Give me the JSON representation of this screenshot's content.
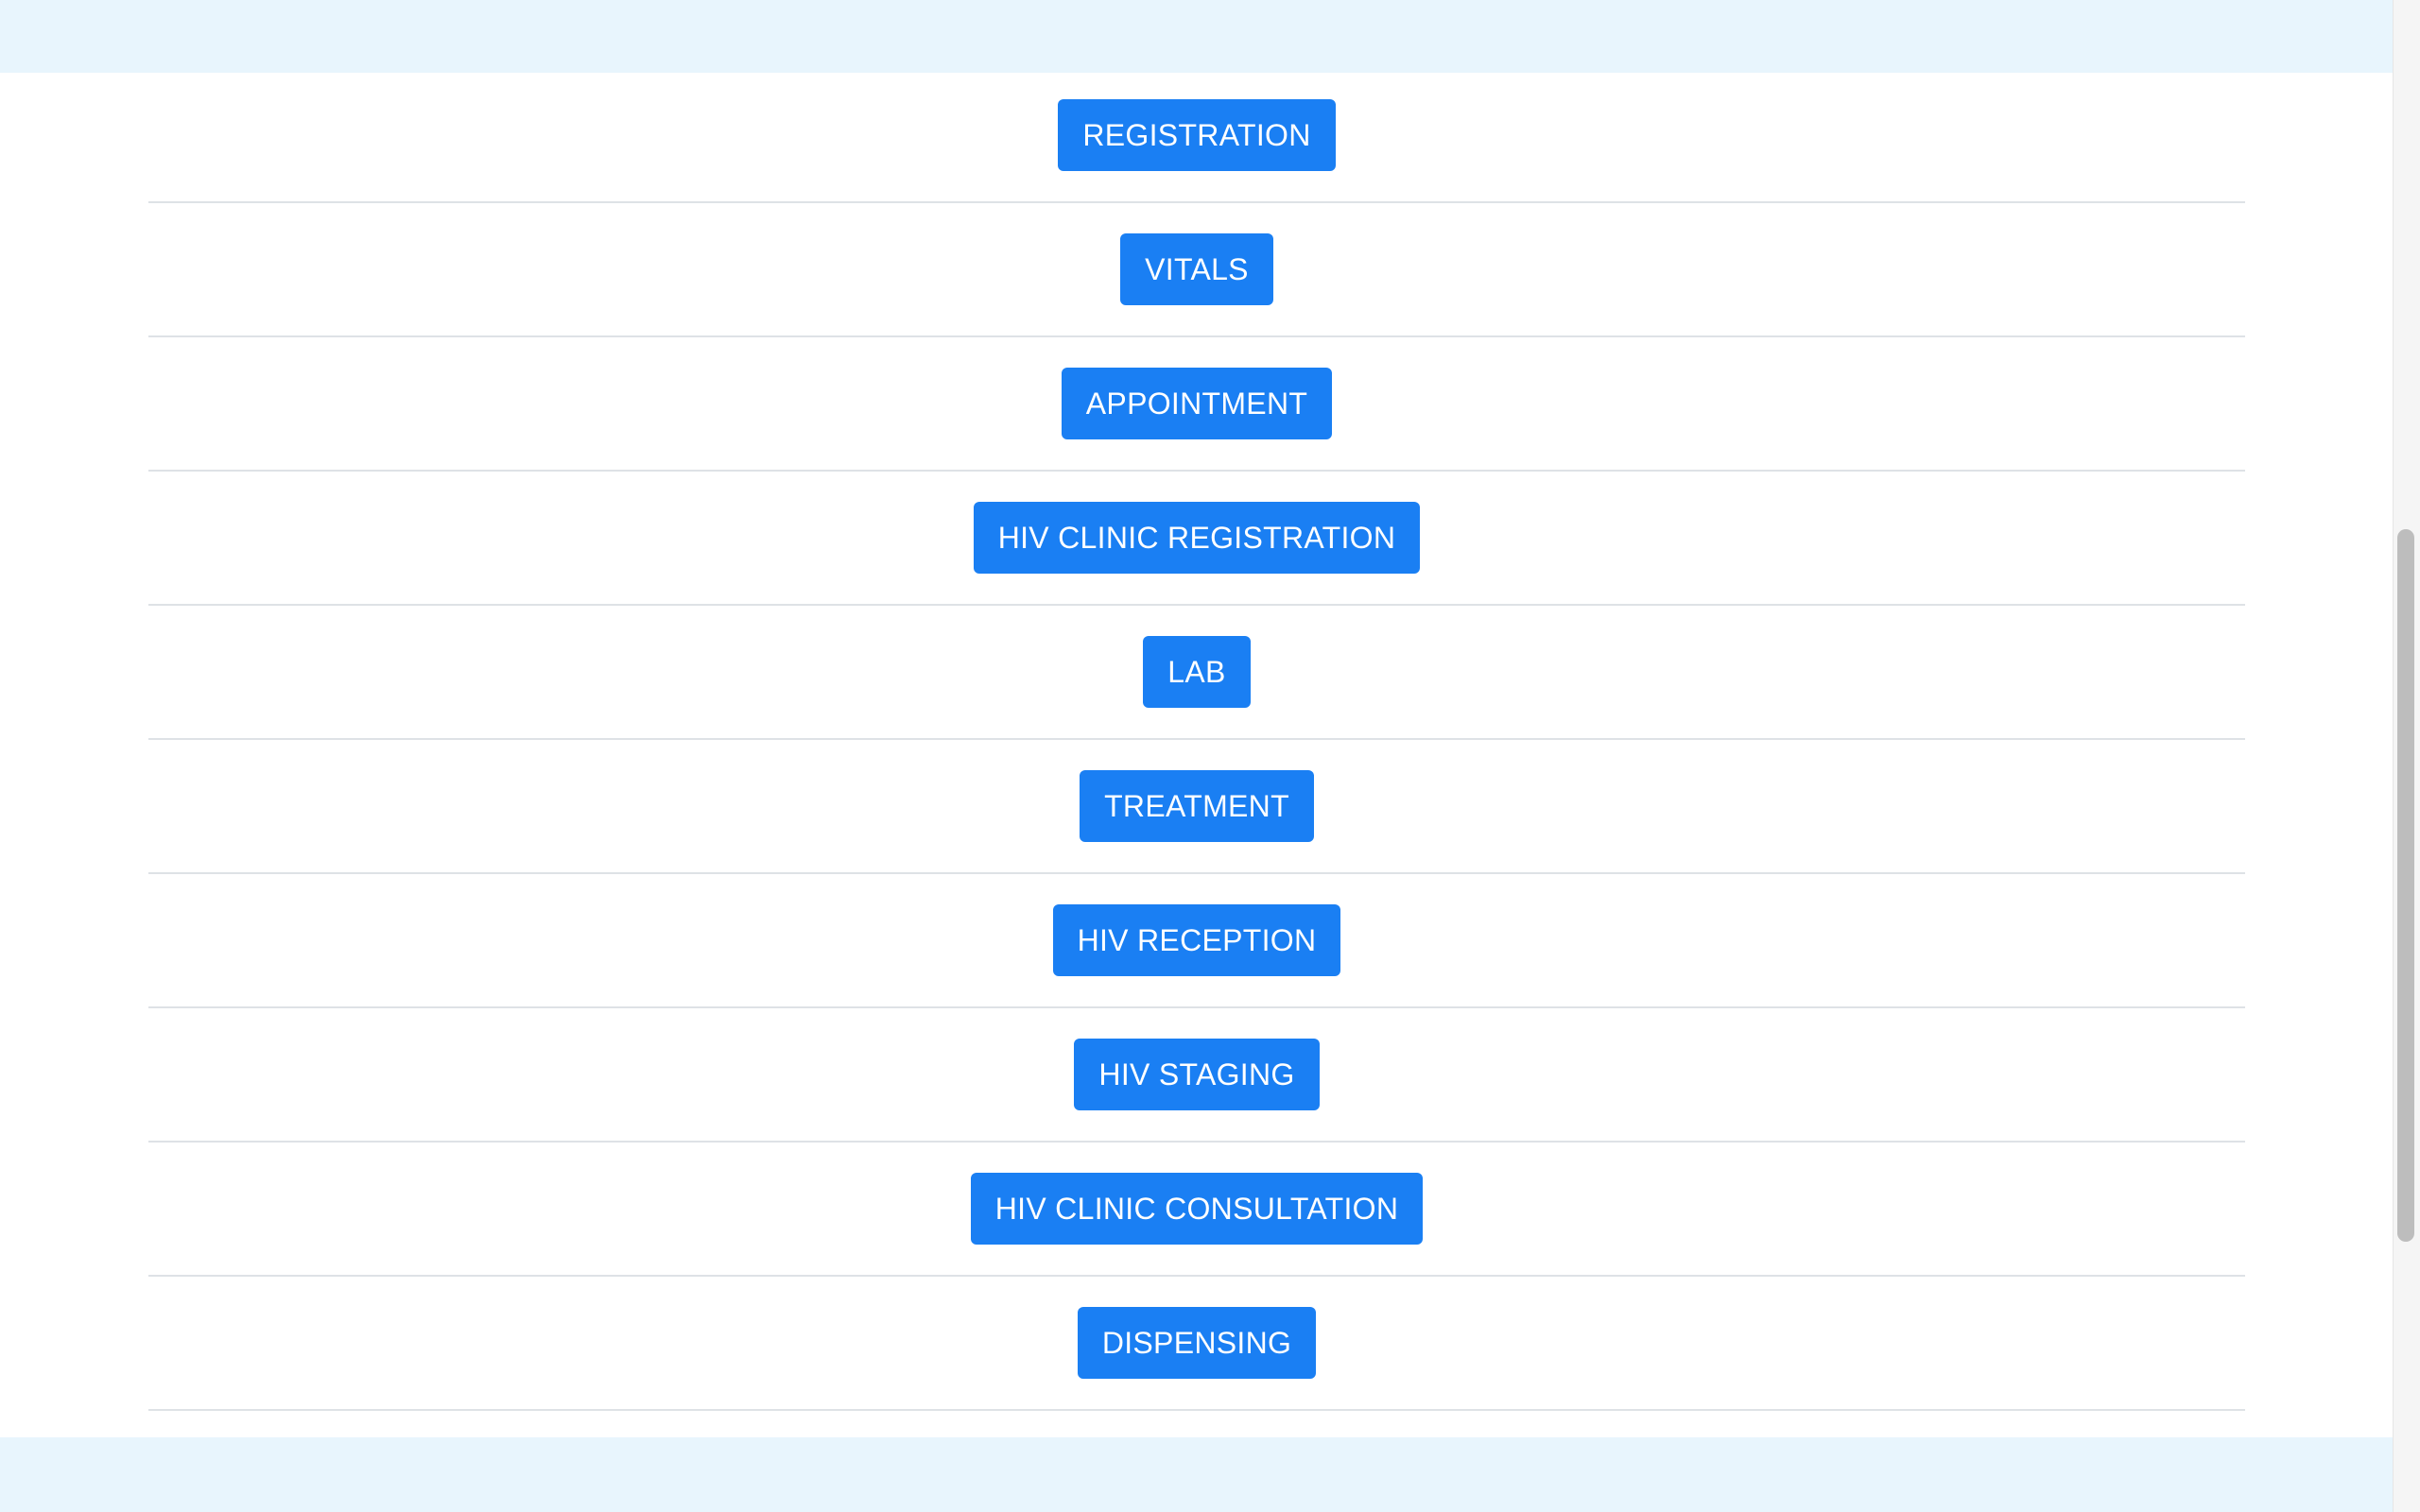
{
  "tasks": [
    {
      "label": "REGISTRATION"
    },
    {
      "label": "VITALS"
    },
    {
      "label": "APPOINTMENT"
    },
    {
      "label": "HIV CLINIC REGISTRATION"
    },
    {
      "label": "LAB"
    },
    {
      "label": "TREATMENT"
    },
    {
      "label": "HIV RECEPTION"
    },
    {
      "label": "HIV STAGING"
    },
    {
      "label": "HIV CLINIC CONSULTATION"
    },
    {
      "label": "DISPENSING"
    }
  ],
  "colors": {
    "page_background": "#e8f5fd",
    "panel_background": "#ffffff",
    "button_background": "#1a7ff3",
    "button_text": "#ffffff",
    "row_divider": "#dee2e6",
    "scrollbar_thumb": "#bdbdbd"
  }
}
